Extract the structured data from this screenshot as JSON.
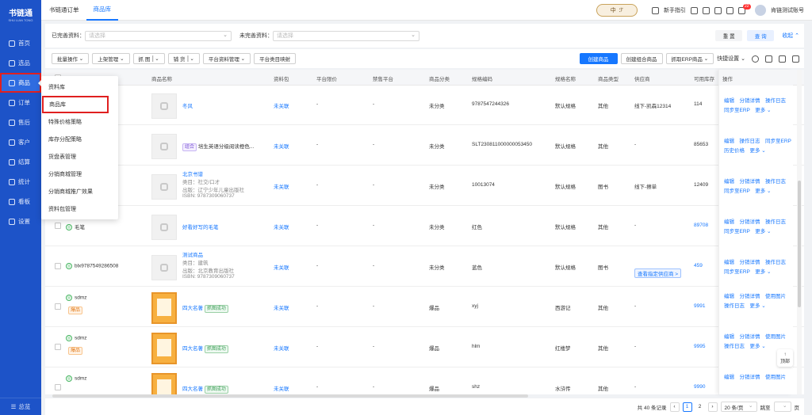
{
  "app": {
    "logo": "书链通",
    "logo_sub": "SHU LIAN TONG"
  },
  "sidebar": {
    "items": [
      {
        "label": "首页"
      },
      {
        "label": "选品"
      },
      {
        "label": "商品"
      },
      {
        "label": "订单"
      },
      {
        "label": "售后"
      },
      {
        "label": "客户"
      },
      {
        "label": "结算"
      },
      {
        "label": "统计"
      },
      {
        "label": "看板"
      },
      {
        "label": "设置"
      }
    ],
    "collapse": "总览"
  },
  "tabs": [
    {
      "label": "书链通订单"
    },
    {
      "label": "商品库"
    }
  ],
  "topbar": {
    "lang_left": "中",
    "lang_right": "ℱ",
    "guide": "新手指引",
    "notify_count": "22",
    "account": "肯链测试账号"
  },
  "filters": {
    "complete_label": "已完善资料：",
    "complete_ph": "请选择",
    "incomplete_label": "未完善资料：",
    "incomplete_ph": "请选择",
    "reset": "重 置",
    "query": "查 询",
    "collapse": "收起"
  },
  "toolbar": {
    "batch": "批量操作",
    "shelf": "上架管理",
    "capture": "抓 图",
    "stock": "铺 货",
    "platform": "平台资料管理",
    "map": "平台类目映射",
    "create": "创建商品",
    "create_combo": "创建组合商品",
    "fetch_erp": "抓取ERP商品",
    "quick": "快捷设置"
  },
  "columns": [
    "商品名称",
    "资料包",
    "平台限价",
    "禁售平台",
    "商品分类",
    "规格编码",
    "规格名称",
    "商品类型",
    "供应商",
    "可用库存",
    "操作"
  ],
  "dropdown": [
    "资料库",
    "商品库",
    "特殊价格策略",
    "库存分配策略",
    "货盘表管理",
    "分销商城管理",
    "分销商城推广效果",
    "资料包管理"
  ],
  "rows": [
    {
      "code": "",
      "tag": "",
      "name": "冬风",
      "meta1": "",
      "meta2": "",
      "meta3": "",
      "pack": "未关联",
      "limit": "-",
      "ban": "-",
      "cat": "未分类",
      "spec": "9787547244326",
      "specname": "默认规格",
      "type": "其他",
      "supplier": "线下-凯森12314",
      "stock": "114",
      "ops1": "编辑　分销详情　操作日志",
      "ops2": "同步至ERP　更多 ⌄"
    },
    {
      "code": "0053450",
      "tag": "组合",
      "name": "培生英语分级阅读橙色...",
      "meta1": "",
      "meta2": "",
      "meta3": "",
      "pack": "未关联",
      "limit": "-",
      "ban": "-",
      "cat": "未分类",
      "spec": "SLT230811000000053450",
      "specname": "默认规格",
      "type": "其他",
      "supplier": "-",
      "stock": "85653",
      "ops1": "编辑　操作日志　同步至ERP",
      "ops2": "历史价格　更多 ⌄"
    },
    {
      "code": "",
      "tag": "",
      "name": "北京书谱",
      "meta1": "类目：社交/口才",
      "meta2": "出版：辽宁少年儿童出版社",
      "meta3": "ISBN: 9787309060737",
      "pack": "未关联",
      "limit": "-",
      "ban": "-",
      "cat": "未分类",
      "spec": "10013074",
      "specname": "默认规格",
      "type": "图书",
      "supplier": "线下-擦单",
      "stock": "12409",
      "ops1": "编辑　分销详情　操作日志",
      "ops2": "同步至ERP　更多 ⌄"
    },
    {
      "code": "毛笔",
      "tag": "",
      "name": "好看好写的毛笔",
      "meta1": "",
      "meta2": "",
      "meta3": "",
      "pack": "未关联",
      "limit": "-",
      "ban": "-",
      "cat": "未分类",
      "spec": "红色",
      "specname": "默认规格",
      "type": "其他",
      "supplier": "-",
      "stock": "89708",
      "ops1": "编辑　分销详情　操作日志",
      "ops2": "同步至ERP　更多 ⌄"
    },
    {
      "code": "blx9787549286508",
      "tag": "",
      "name": "测试商品",
      "meta1": "类目：建筑",
      "meta2": "出版：北京教育出版社",
      "meta3": "ISBN: 9787309060737",
      "pack": "未关联",
      "limit": "-",
      "ban": "-",
      "cat": "未分类",
      "spec": "蓝色",
      "specname": "默认规格",
      "type": "图书",
      "supplier": "查看指定供应商 >",
      "stock": "459",
      "ops1": "编辑　分销详情　操作日志",
      "ops2": "同步至ERP　更多 ⌄"
    },
    {
      "code": "sdmz",
      "tag": "爆品",
      "name": "四大名著",
      "meta1": "",
      "meta2": "",
      "meta3": "",
      "pack": "未关联",
      "limit": "-",
      "ban": "-",
      "cat": "爆品",
      "spec": "xyj",
      "specname": "西游记",
      "type": "其他",
      "supplier": "-",
      "stock": "9991",
      "ops1": "编辑　分销详情　使用图片",
      "ops2": "操作日志　更多 ⌄"
    },
    {
      "code": "sdmz",
      "tag": "爆品",
      "name": "四大名著",
      "meta1": "",
      "meta2": "",
      "meta3": "",
      "pack": "未关联",
      "limit": "-",
      "ban": "-",
      "cat": "爆品",
      "spec": "hlm",
      "specname": "红楼梦",
      "type": "其他",
      "supplier": "-",
      "stock": "9995",
      "ops1": "编辑　分销详情　使用图片",
      "ops2": "操作日志　更多 ⌄"
    },
    {
      "code": "sdmz",
      "tag": "",
      "name": "四大名著",
      "meta1": "",
      "meta2": "",
      "meta3": "",
      "pack": "未关联",
      "limit": "-",
      "ban": "-",
      "cat": "爆品",
      "spec": "shz",
      "specname": "水浒传",
      "type": "其他",
      "supplier": "-",
      "stock": "9990",
      "ops1": "编辑　分销详情　使用图片",
      "ops2": ""
    }
  ],
  "capture_tag": "抓图成功",
  "pager": {
    "total": "共 40 条记录",
    "p1": "1",
    "p2": "2",
    "size": "20 条/页",
    "jump": "跳至",
    "page": "页"
  },
  "backtop": "顶部"
}
